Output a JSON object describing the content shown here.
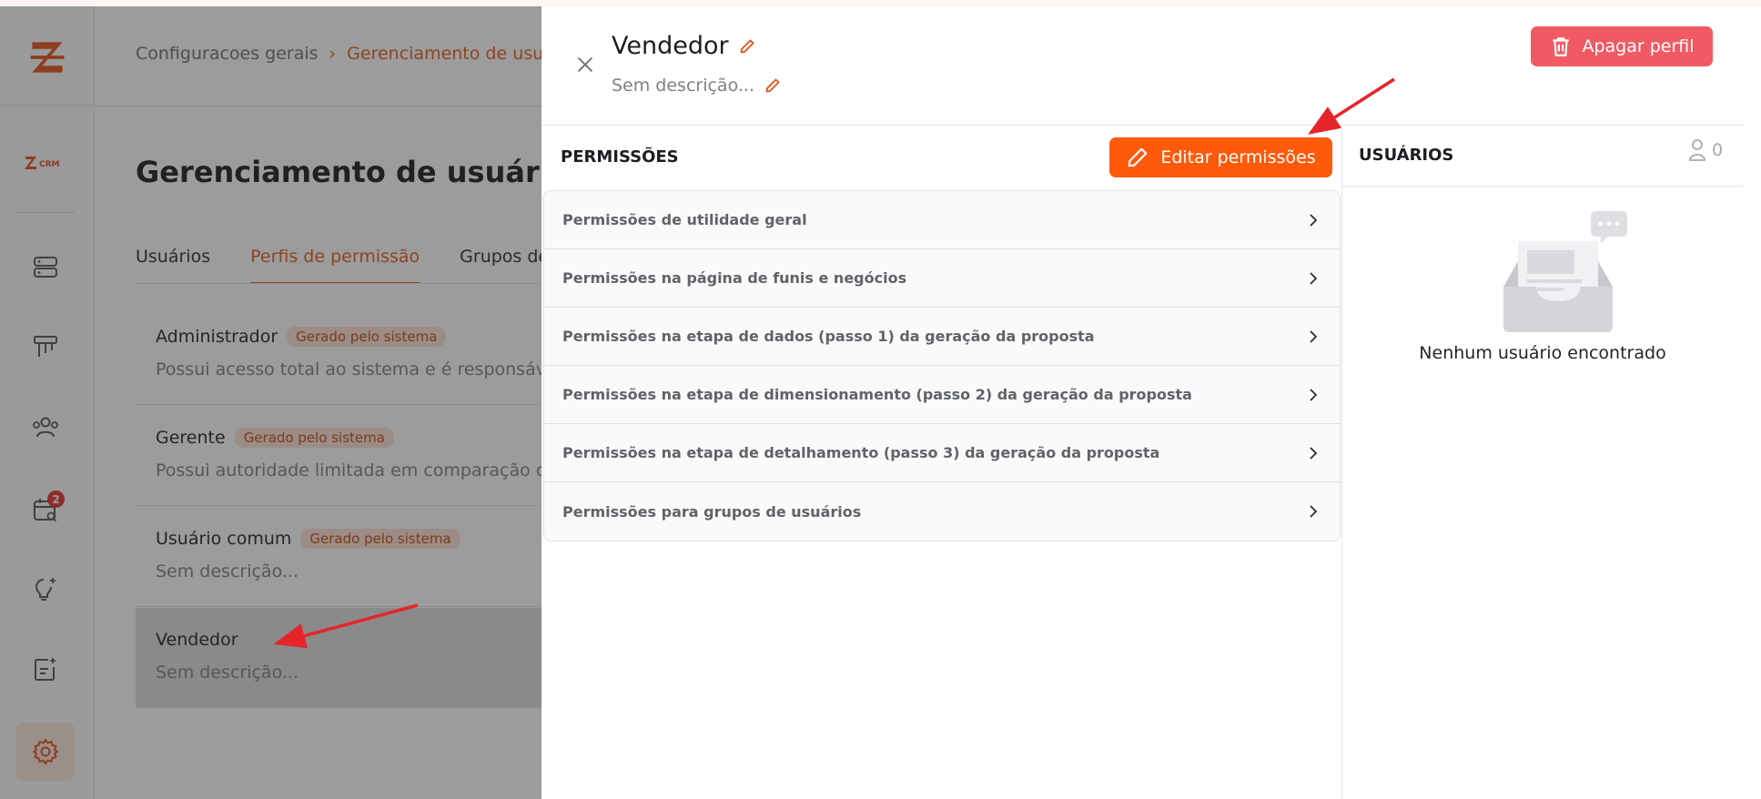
{
  "app": {
    "breadcrumb": {
      "root": "Configuracoes gerais",
      "current": "Gerenciamento de usuários"
    },
    "page_title": "Gerenciamento de usuários",
    "notification_count": "2",
    "tabs": [
      {
        "label": "Usuários"
      },
      {
        "label": "Perfis de permissão"
      },
      {
        "label": "Grupos de"
      }
    ],
    "profiles": [
      {
        "name": "Administrador",
        "tag": "Gerado pelo sistema",
        "description": "Possui acesso total ao sistema e é responsável"
      },
      {
        "name": "Gerente",
        "tag": "Gerado pelo sistema",
        "description": "Possui autoridade limitada em comparação com"
      },
      {
        "name": "Usuário comum",
        "tag": "Gerado pelo sistema",
        "description": "Sem descrição..."
      },
      {
        "name": "Vendedor",
        "tag": "",
        "description": "Sem descrição..."
      }
    ],
    "colors": {
      "accent": "#ff5a0a",
      "danger": "#f25a63"
    }
  },
  "drawer": {
    "title": "Vendedor",
    "description": "Sem descrição...",
    "delete_label": "Apagar perfil",
    "permissions": {
      "title": "PERMISSÕES",
      "edit_label": "Editar permissões",
      "items": [
        {
          "label": "Permissões de utilidade geral"
        },
        {
          "label": "Permissões na página de funis e negócios"
        },
        {
          "label": "Permissões na etapa de dados (passo 1) da geração da proposta"
        },
        {
          "label": "Permissões na etapa de dimensionamento (passo 2) da geração da proposta"
        },
        {
          "label": "Permissões na etapa de detalhamento (passo 3) da geração da proposta"
        },
        {
          "label": "Permissões para grupos de usuários"
        }
      ]
    },
    "users": {
      "title": "USUÁRIOS",
      "count": "0",
      "empty_text": "Nenhum usuário encontrado"
    }
  }
}
